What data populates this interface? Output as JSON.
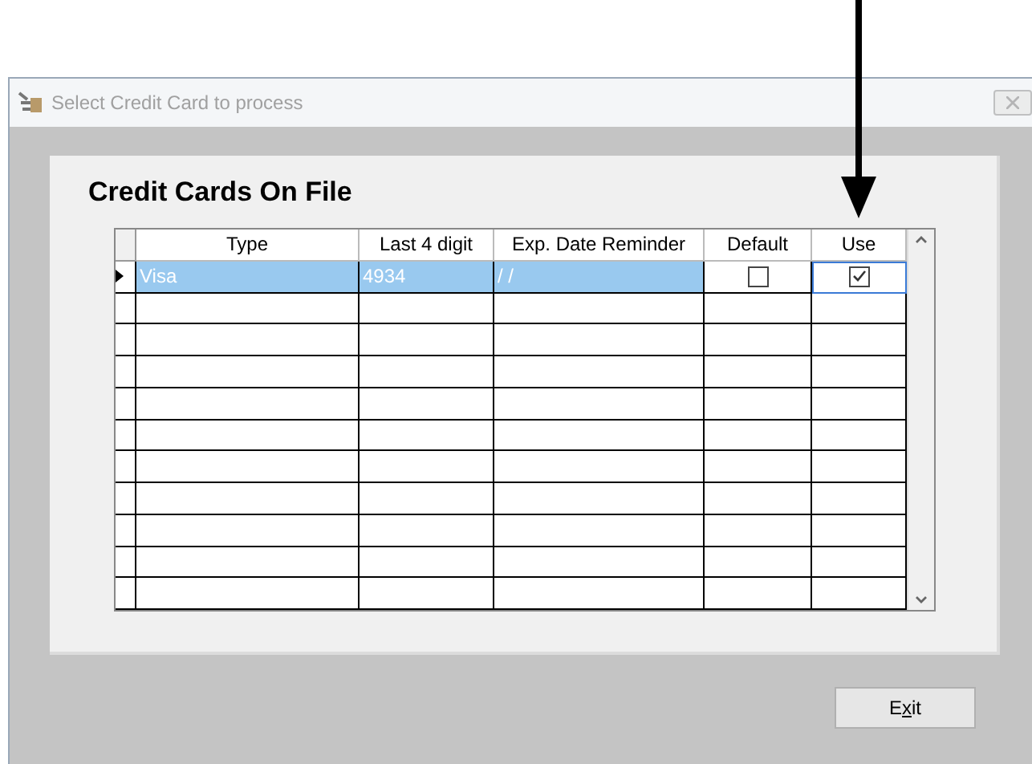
{
  "window": {
    "title": "Select Credit Card to process",
    "close_disabled": true
  },
  "panel": {
    "title": "Credit Cards On File"
  },
  "table": {
    "columns": [
      "Type",
      "Last 4 digit",
      "Exp. Date Reminder",
      "Default",
      "Use"
    ],
    "rows": [
      {
        "selected": true,
        "type": "Visa",
        "last4": "4934",
        "exp": "/  /",
        "default": false,
        "use": true
      },
      {
        "selected": false
      },
      {
        "selected": false
      },
      {
        "selected": false
      },
      {
        "selected": false
      },
      {
        "selected": false
      },
      {
        "selected": false
      },
      {
        "selected": false
      },
      {
        "selected": false
      },
      {
        "selected": false
      },
      {
        "selected": false
      }
    ]
  },
  "exit_button": {
    "label": "Exit"
  }
}
